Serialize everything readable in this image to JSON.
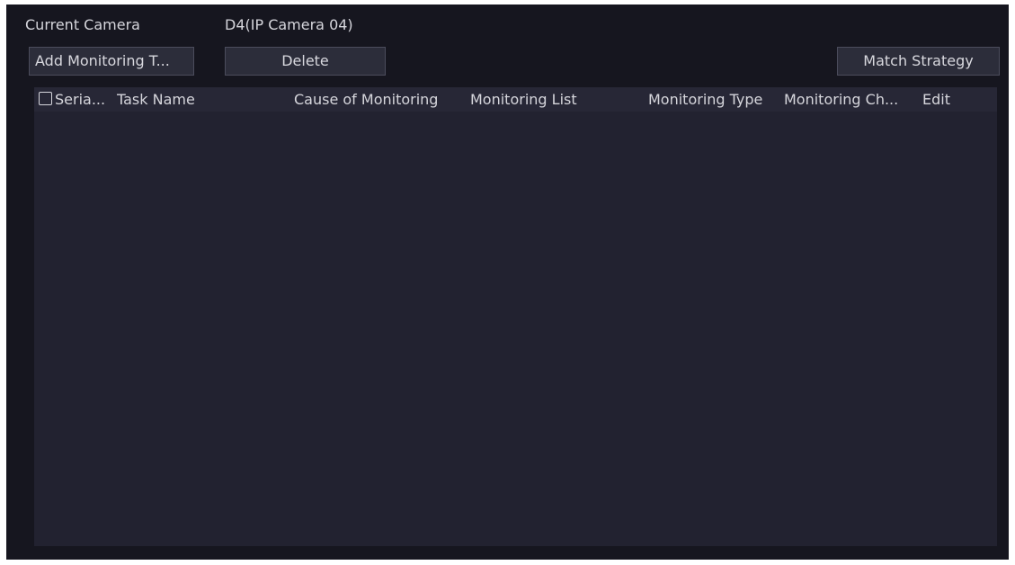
{
  "header": {
    "current_camera_label": "Current Camera",
    "current_camera_value": "D4(IP Camera 04)"
  },
  "toolbar": {
    "add_label": "Add Monitoring T...",
    "delete_label": "Delete",
    "match_strategy_label": "Match Strategy"
  },
  "table": {
    "columns": [
      "Seria...",
      "Task Name",
      "Cause of Monitoring",
      "Monitoring List",
      "Monitoring Type",
      "Monitoring Ch...",
      "Edit"
    ],
    "select_all_checked": false,
    "rows": []
  }
}
